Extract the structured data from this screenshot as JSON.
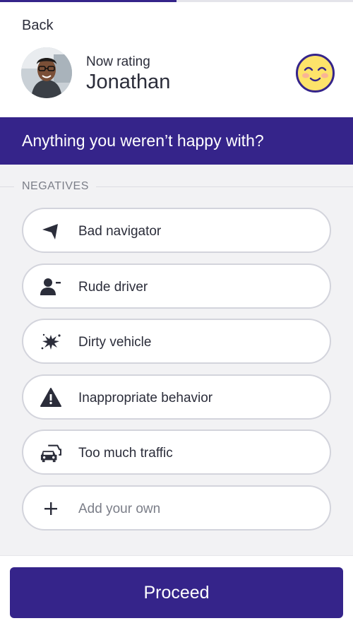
{
  "progress": {
    "fraction": 0.5,
    "color": "#35248a"
  },
  "header": {
    "back_label": "Back",
    "rating_caption": "Now rating",
    "driver_name": "Jonathan",
    "mood_icon": "smiling-emoji"
  },
  "question": {
    "text": "Anything you weren’t happy with?"
  },
  "section": {
    "label": "NEGATIVES"
  },
  "options": [
    {
      "label": "Bad navigator",
      "icon": "navigation-arrow-icon"
    },
    {
      "label": "Rude driver",
      "icon": "person-minus-icon"
    },
    {
      "label": "Dirty vehicle",
      "icon": "splat-icon"
    },
    {
      "label": "Inappropriate behavior",
      "icon": "warning-icon"
    },
    {
      "label": "Too much traffic",
      "icon": "cars-icon"
    },
    {
      "label": "Add your own",
      "icon": "plus-icon"
    }
  ],
  "footer": {
    "proceed_label": "Proceed"
  },
  "colors": {
    "brand": "#35248a",
    "background": "#f2f2f4",
    "text": "#2b2d3a",
    "muted": "#7b7e88"
  }
}
